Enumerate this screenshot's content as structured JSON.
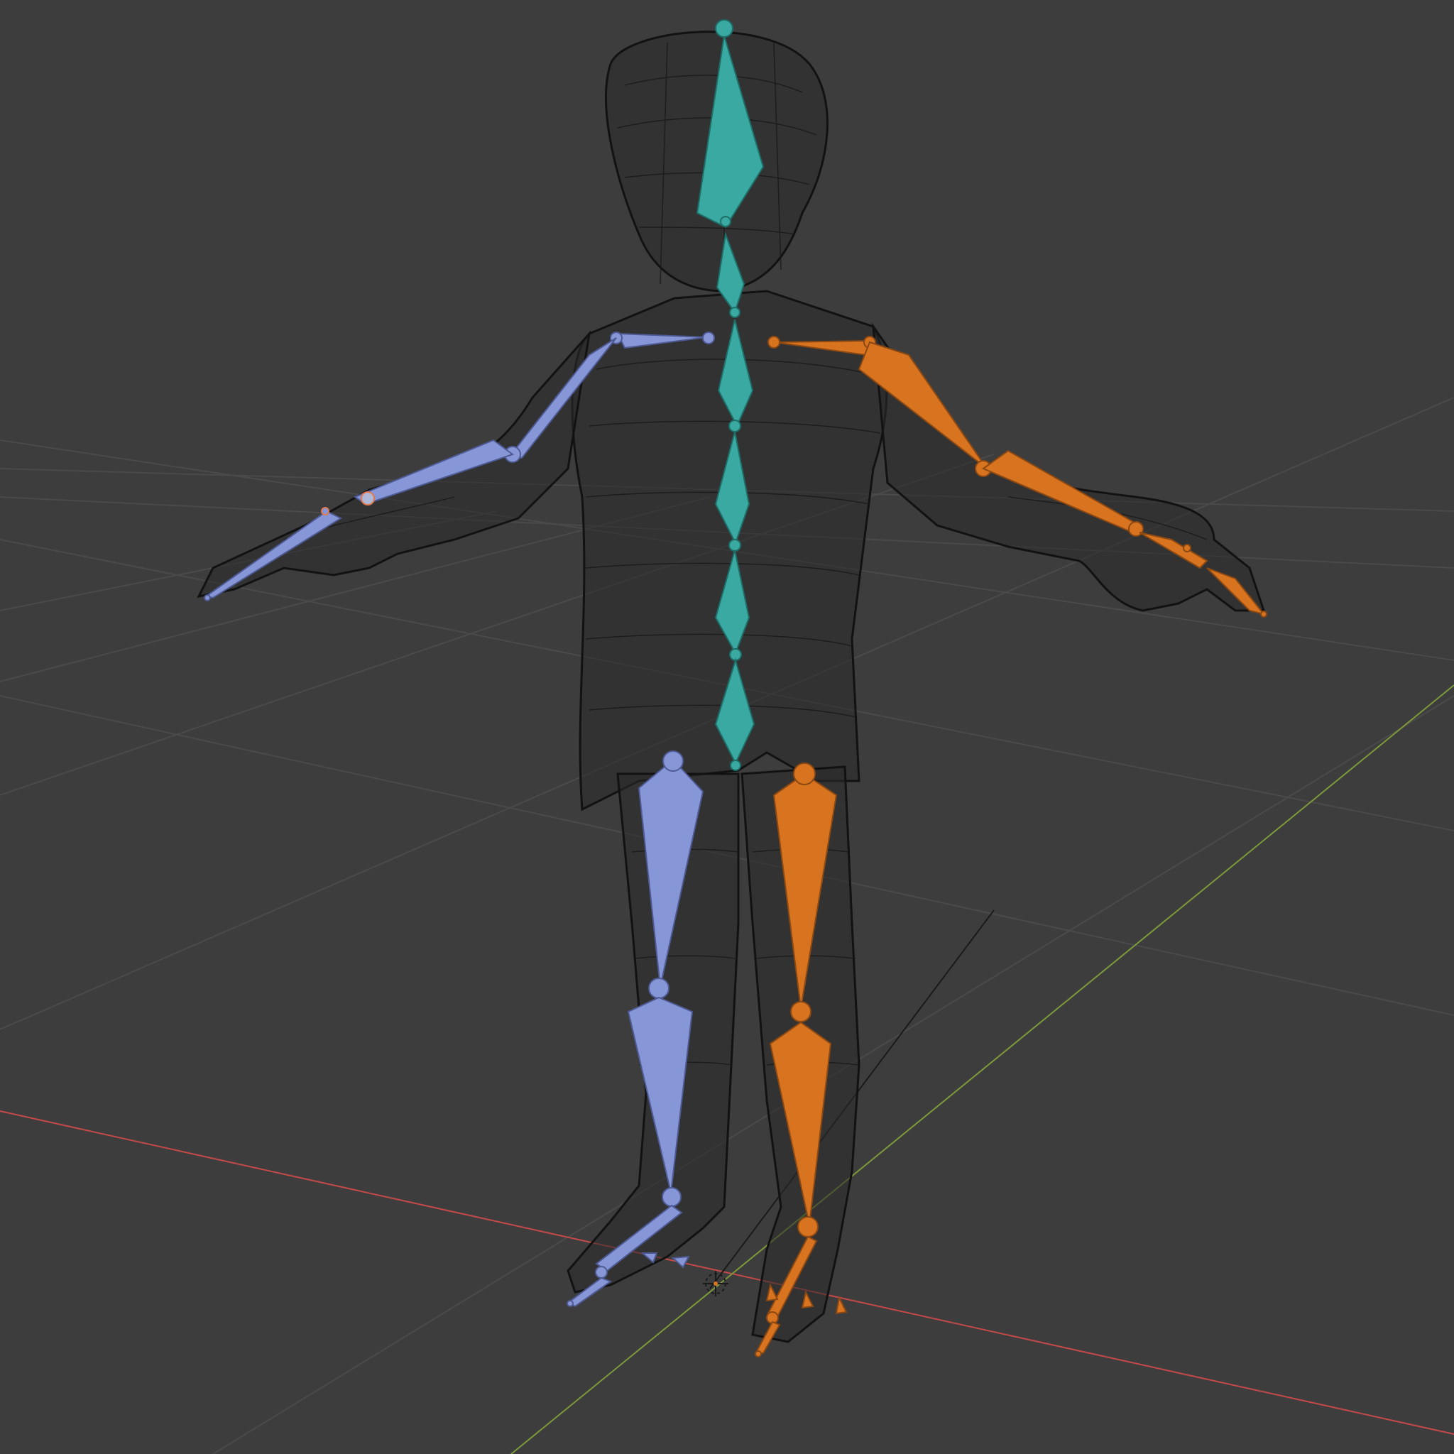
{
  "viewport": {
    "background": "#3d3d3d",
    "grid_color": "#484848",
    "x_axis_color": "#c44a4a",
    "y_axis_color": "#7d9a3a",
    "wire_color": "#141414"
  },
  "armature": {
    "center_color": "#3aa9a1",
    "left_color": "#8796d6",
    "right_color": "#d8741f",
    "bones": [
      {
        "id": "head",
        "side": "center"
      },
      {
        "id": "neck",
        "side": "center"
      },
      {
        "id": "spine-4",
        "side": "center"
      },
      {
        "id": "spine-3",
        "side": "center"
      },
      {
        "id": "spine-2",
        "side": "center"
      },
      {
        "id": "spine-1",
        "side": "center"
      },
      {
        "id": "hips",
        "side": "center"
      },
      {
        "id": "shoulder-left",
        "side": "left"
      },
      {
        "id": "upper-arm-left",
        "side": "left"
      },
      {
        "id": "forearm-left",
        "side": "left"
      },
      {
        "id": "hand-left",
        "side": "left"
      },
      {
        "id": "thigh-left",
        "side": "left"
      },
      {
        "id": "shin-left",
        "side": "left"
      },
      {
        "id": "foot-left",
        "side": "left"
      },
      {
        "id": "shoulder-right",
        "side": "right"
      },
      {
        "id": "upper-arm-right",
        "side": "right"
      },
      {
        "id": "forearm-right",
        "side": "right"
      },
      {
        "id": "hand-right",
        "side": "right"
      },
      {
        "id": "thigh-right",
        "side": "right"
      },
      {
        "id": "shin-right",
        "side": "right"
      },
      {
        "id": "foot-right",
        "side": "right"
      }
    ]
  }
}
